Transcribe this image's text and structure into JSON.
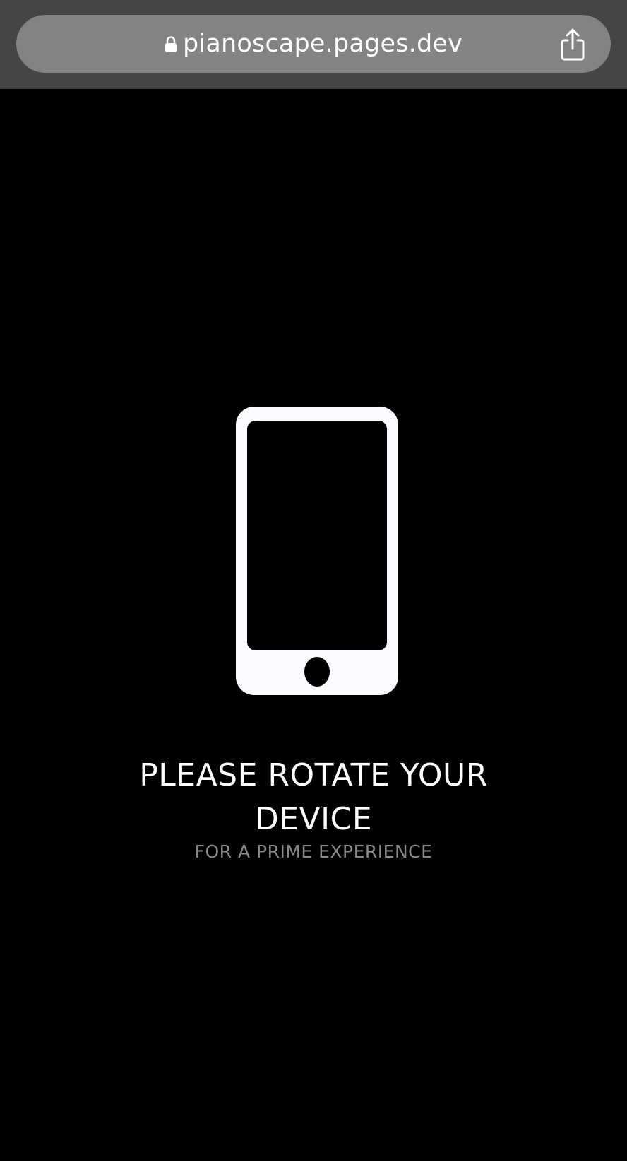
{
  "browser": {
    "url": "pianoscape.pages.dev",
    "lock_icon": "lock-icon",
    "share_icon": "share-icon"
  },
  "rotate_prompt": {
    "icon": "smartphone-icon",
    "headline_line1": "PLEASE ROTATE YOUR",
    "headline_line2": "DEVICE",
    "subtitle": "FOR A PRIME EXPERIENCE"
  },
  "colors": {
    "page_background": "#000000",
    "toolbar_background": "#454548",
    "url_pill": "#838385",
    "headline": "#ffffff",
    "subtitle": "#8a8a8a"
  }
}
